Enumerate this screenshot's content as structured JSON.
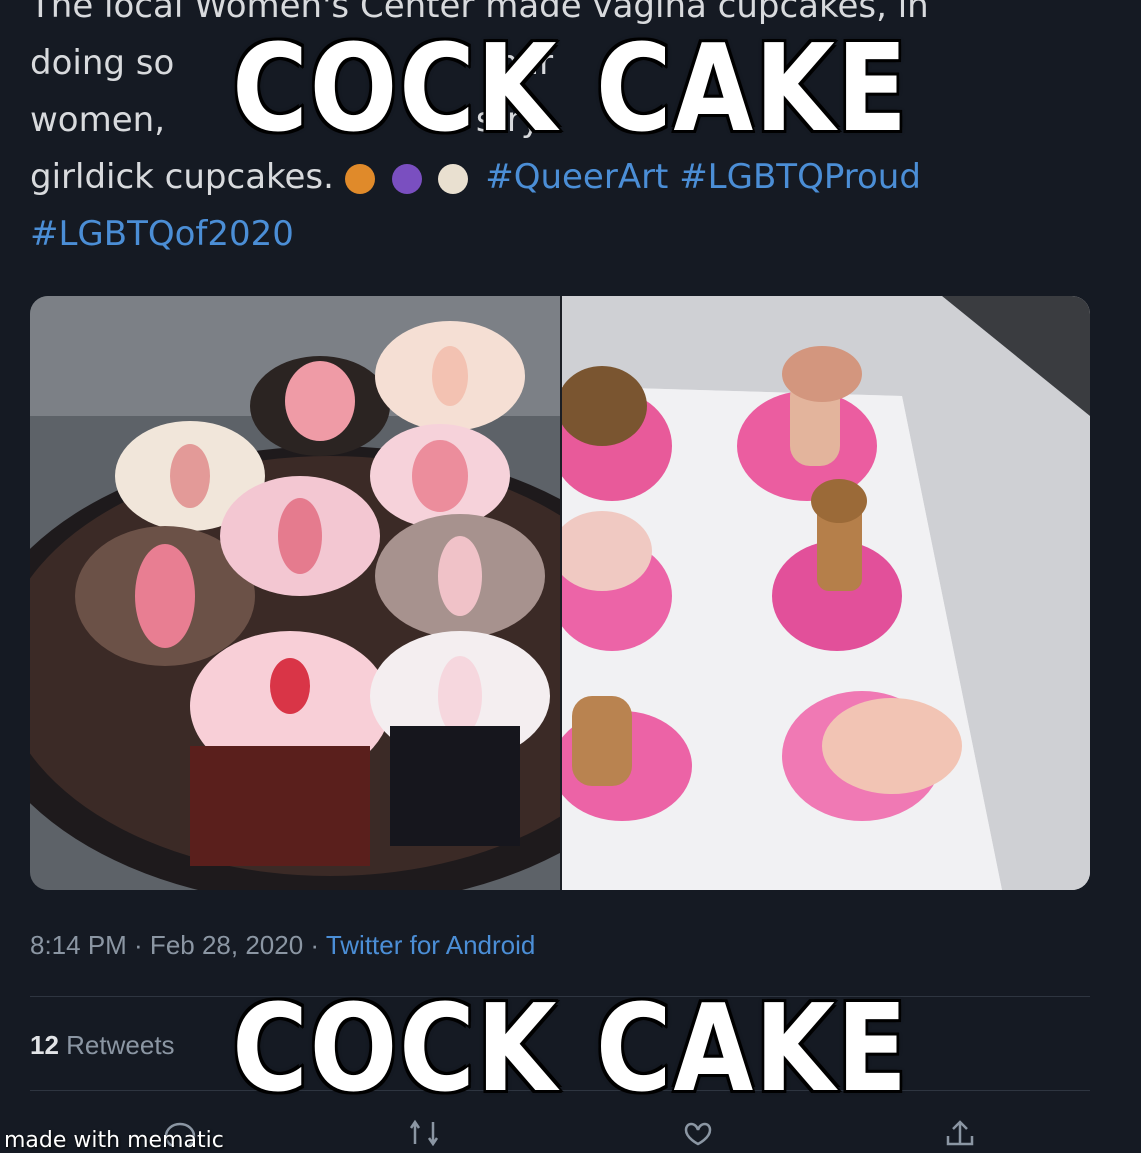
{
  "tweet": {
    "lines": [
      "The local Women's Center made vagina cupcakes, in",
      "doing so",
      "women,",
      "girldick cupcakes."
    ],
    "line2_rest": "mar",
    "line3_rest": "stry",
    "hashtag_inline": "#QueerArt #LGBTQProud",
    "hashtag_line": "#LGBTQof2020",
    "meta_time": "8:14 PM · Feb 28, 2020 · ",
    "meta_source": "Twitter for Android",
    "retweet_count": "12",
    "retweet_label": "Retweets"
  },
  "meme": {
    "top_caption": "COCK CAKE",
    "bottom_caption": "COCK CAKE",
    "watermark": "made with mematic"
  },
  "icons": [
    "reply-icon",
    "retweet-icon",
    "like-icon",
    "share-icon"
  ],
  "colors": {
    "background": "#151a23",
    "link": "#4b8ed6",
    "text": "#d8dadd"
  }
}
